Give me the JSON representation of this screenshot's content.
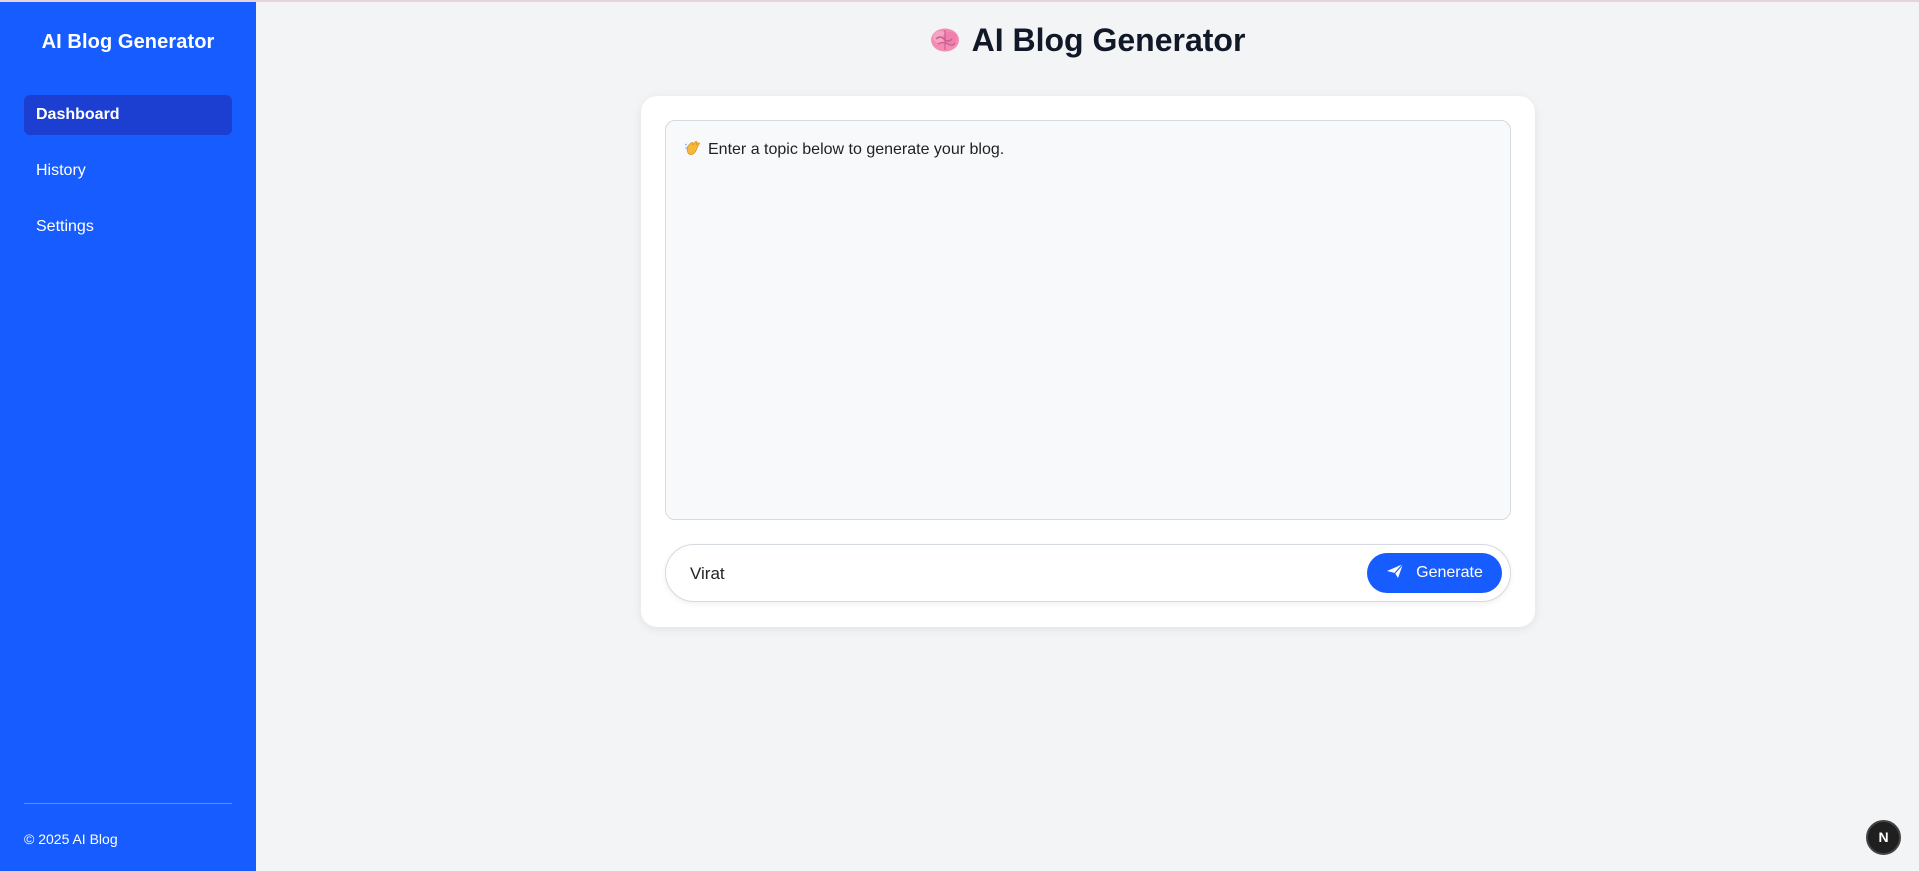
{
  "sidebar": {
    "brand": "AI Blog Generator",
    "items": [
      {
        "label": "Dashboard",
        "active": true
      },
      {
        "label": "History",
        "active": false
      },
      {
        "label": "Settings",
        "active": false
      }
    ],
    "footer": "© 2025 AI Blog"
  },
  "header": {
    "icon": "brain-icon",
    "title": "AI Blog Generator"
  },
  "output": {
    "icon": "waving-hand-icon",
    "message": "Enter a topic below to generate your blog."
  },
  "composer": {
    "topic_value": "Virat",
    "button_icon": "send-icon",
    "button_label": "Generate"
  },
  "badge": {
    "label": "N"
  },
  "colors": {
    "accent": "#175cff",
    "active_nav": "#1d3fd1",
    "background": "#f3f4f6"
  }
}
